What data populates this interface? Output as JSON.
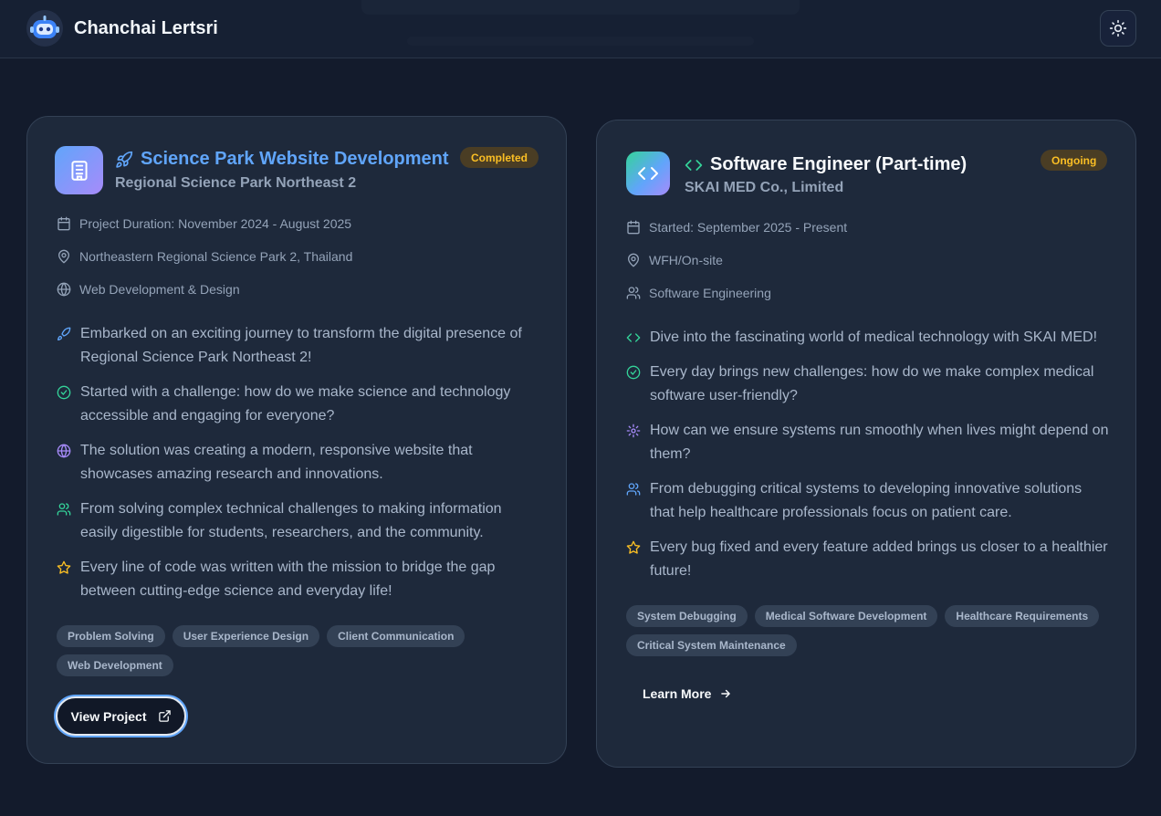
{
  "header": {
    "brand": "Chanchai Lertsri",
    "logo_icon": "robot-icon",
    "theme_icon": "sun-icon"
  },
  "colors": {
    "background": "#131b2c",
    "card": "#1e293b",
    "accent_blue": "#60a5fa",
    "badge_text": "#fbbf24",
    "green": "#34d399",
    "purple": "#a78bfa"
  },
  "cards": [
    {
      "title": "Science Park Website Development",
      "organization": "Regional Science Park Northeast 2",
      "status": "Completed",
      "icon": "building-icon",
      "title_icon": "rocket-icon",
      "meta": [
        {
          "icon": "calendar-icon",
          "text": "Project Duration: November 2024 - August 2025"
        },
        {
          "icon": "map-pin-icon",
          "text": "Northeastern Regional Science Park 2, Thailand"
        },
        {
          "icon": "globe-icon",
          "text": "Web Development & Design"
        }
      ],
      "bullets": [
        {
          "icon": "rocket-icon",
          "text": "Embarked on an exciting journey to transform the digital presence of Regional Science Park Northeast 2!"
        },
        {
          "icon": "check-circle-icon",
          "text": "Started with a challenge: how do we make science and technology accessible and engaging for everyone?"
        },
        {
          "icon": "globe-icon",
          "text": "The solution was creating a modern, responsive website that showcases amazing research and innovations."
        },
        {
          "icon": "users-icon",
          "text": "From solving complex technical challenges to making information easily digestible for students, researchers, and the community."
        },
        {
          "icon": "star-icon",
          "text": "Every line of code was written with the mission to bridge the gap between cutting-edge science and everyday life!"
        }
      ],
      "tags": [
        "Problem Solving",
        "User Experience Design",
        "Client Communication",
        "Web Development"
      ],
      "action": "View Project",
      "action_icon": "external-link-icon"
    },
    {
      "title": "Software Engineer (Part-time)",
      "organization": "SKAI MED Co., Limited",
      "status": "Ongoing",
      "icon": "code-icon",
      "title_icon": "code-icon",
      "meta": [
        {
          "icon": "calendar-icon",
          "text": "Started: September 2025 - Present"
        },
        {
          "icon": "map-pin-icon",
          "text": "WFH/On-site"
        },
        {
          "icon": "users-icon",
          "text": "Software Engineering"
        }
      ],
      "bullets": [
        {
          "icon": "code-icon",
          "text": "Dive into the fascinating world of medical technology with SKAI MED!"
        },
        {
          "icon": "check-circle-icon",
          "text": "Every day brings new challenges: how do we make complex medical software user-friendly?"
        },
        {
          "icon": "gear-icon",
          "text": "How can we ensure systems run smoothly when lives might depend on them?"
        },
        {
          "icon": "users-icon",
          "text": "From debugging critical systems to developing innovative solutions that help healthcare professionals focus on patient care."
        },
        {
          "icon": "star-icon",
          "text": "Every bug fixed and every feature added brings us closer to a healthier future!"
        }
      ],
      "tags": [
        "System Debugging",
        "Medical Software Development",
        "Healthcare Requirements",
        "Critical System Maintenance"
      ],
      "action": "Learn More",
      "action_icon": "arrow-right-icon"
    }
  ]
}
